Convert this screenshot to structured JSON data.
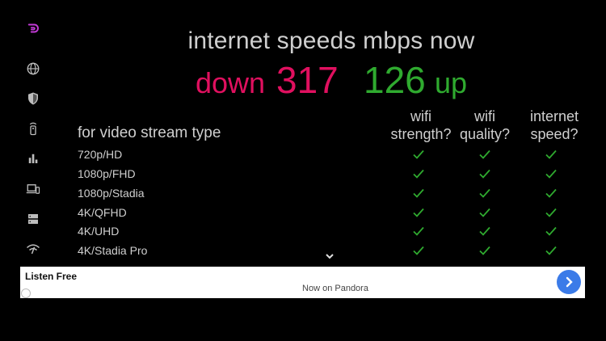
{
  "header": {
    "title": "internet speeds mbps now",
    "down_label": "down",
    "down_value": "317",
    "up_value": "126",
    "up_label": "up"
  },
  "colors": {
    "down": "#e0105f",
    "up": "#2faa2f",
    "check": "#2faa2f",
    "logo": "#c23ad6"
  },
  "sidebar": {
    "items": [
      {
        "icon": "logo-icon"
      },
      {
        "icon": "globe-icon"
      },
      {
        "icon": "shield-icon"
      },
      {
        "icon": "remote-icon"
      },
      {
        "icon": "bar-chart-icon"
      },
      {
        "icon": "devices-icon"
      },
      {
        "icon": "server-icon"
      },
      {
        "icon": "wifi-icon"
      }
    ]
  },
  "table": {
    "label_header": "for video stream type",
    "columns": [
      {
        "line1": "wifi",
        "line2": "strength?"
      },
      {
        "line1": "wifi",
        "line2": "quality?"
      },
      {
        "line1": "internet",
        "line2": "speed?"
      }
    ],
    "rows": [
      {
        "label": "720p/HD",
        "checks": [
          true,
          true,
          true
        ]
      },
      {
        "label": "1080p/FHD",
        "checks": [
          true,
          true,
          true
        ]
      },
      {
        "label": "1080p/Stadia",
        "checks": [
          true,
          true,
          true
        ]
      },
      {
        "label": "4K/QFHD",
        "checks": [
          true,
          true,
          true
        ]
      },
      {
        "label": "4K/UHD",
        "checks": [
          true,
          true,
          true
        ]
      },
      {
        "label": "4K/Stadia Pro",
        "checks": [
          true,
          true,
          true
        ]
      }
    ]
  },
  "ad": {
    "title": "Listen Free",
    "subtitle": "Now on Pandora",
    "button_icon": "chevron-right-icon",
    "info_icon": "info-icon"
  }
}
